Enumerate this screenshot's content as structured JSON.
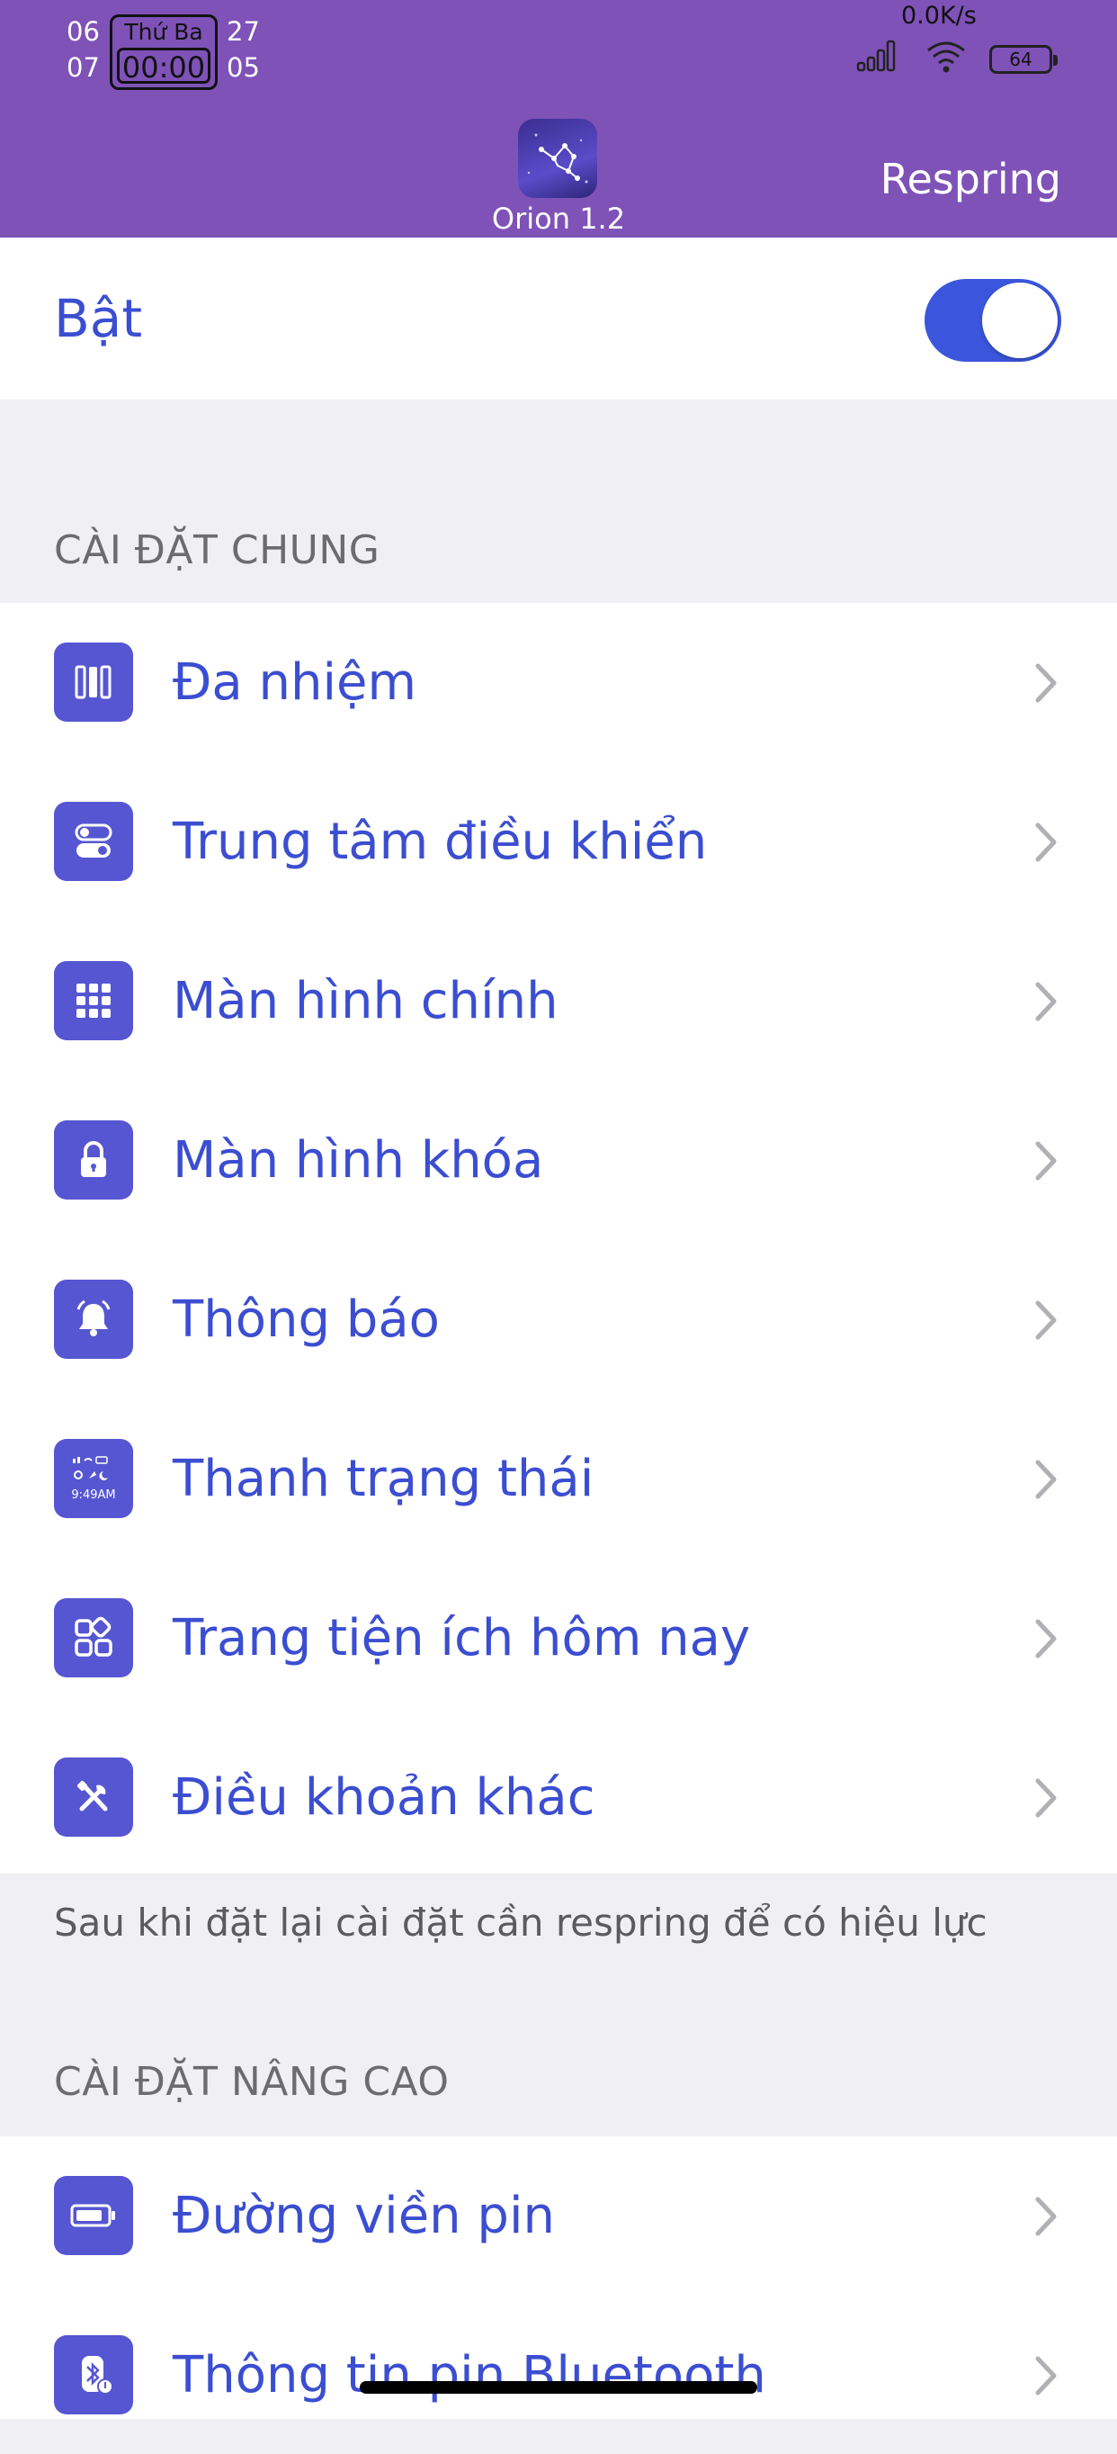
{
  "status_bar": {
    "left_top_1": "06",
    "left_bottom_1": "07",
    "day": "Thứ Ba",
    "time": "00:00",
    "left_top_2": "27",
    "left_bottom_2": "05",
    "net_speed": "0.0K/s",
    "battery": "64"
  },
  "header": {
    "app_title": "Orion 1.2",
    "respring_label": "Respring"
  },
  "toggle": {
    "label": "Bật",
    "on": true,
    "color": "#3b56dc"
  },
  "general": {
    "header": "CÀI ĐẶT CHUNG",
    "items": [
      {
        "label": "Đa nhiệm",
        "icon": "multitask-icon"
      },
      {
        "label": "Trung tâm điều khiển",
        "icon": "control-center-icon"
      },
      {
        "label": "Màn hình chính",
        "icon": "home-grid-icon"
      },
      {
        "label": "Màn hình khóa",
        "icon": "lock-icon"
      },
      {
        "label": "Thông báo",
        "icon": "bell-icon"
      },
      {
        "label": "Thanh trạng thái",
        "icon": "status-bar-icon",
        "icon_text": "9:49AM"
      },
      {
        "label": "Trang tiện ích hôm nay",
        "icon": "widgets-icon"
      },
      {
        "label": "Điều khoản khác",
        "icon": "tools-icon"
      }
    ],
    "footer": "Sau khi đặt lại cài đặt cần respring để có hiệu lực"
  },
  "advanced": {
    "header": "CÀI ĐẶT NÂNG CAO",
    "items": [
      {
        "label": "Đường viền pin",
        "icon": "battery-border-icon"
      },
      {
        "label": "Thông tin pin Bluetooth",
        "icon": "bluetooth-battery-icon"
      }
    ]
  },
  "colors": {
    "header_bg": "#7f52b8",
    "accent": "#3b4ed1",
    "icon_bg": "#5656d2"
  }
}
